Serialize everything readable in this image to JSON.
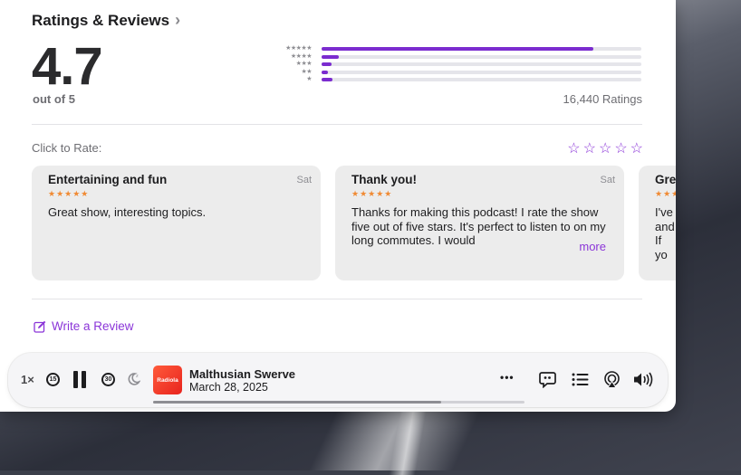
{
  "ratings": {
    "title": "Ratings & Reviews",
    "average": "4.7",
    "out_of": "out of 5",
    "count_label": "16,440 Ratings",
    "histogram": [
      {
        "stars": "★★★★★",
        "fraction": 0.85
      },
      {
        "stars": "★★★★",
        "fraction": 0.055
      },
      {
        "stars": "★★★",
        "fraction": 0.03
      },
      {
        "stars": "★★",
        "fraction": 0.02
      },
      {
        "stars": "★",
        "fraction": 0.035
      }
    ],
    "click_to_rate": "Click to Rate:",
    "rate_star": "☆"
  },
  "reviews": [
    {
      "title": "Entertaining and fun",
      "date": "Sat",
      "stars": "★★★★★",
      "body": "Great show, interesting topics.",
      "more": ""
    },
    {
      "title": "Thank you!",
      "date": "Sat",
      "stars": "★★★★★",
      "body": "Thanks for making this podcast! I rate the show five out of five stars. It's perfect to listen to on my long commutes. I would",
      "more": "more"
    },
    {
      "title": "Gre",
      "date": "",
      "stars": "★★★",
      "body": "I've and If yo",
      "more": ""
    }
  ],
  "write_review": "Write a Review",
  "player": {
    "speed": "1×",
    "skip_back": "15",
    "skip_forward": "30",
    "artwork_text": "Radiola",
    "episode_title": "Malthusian Swerve",
    "episode_date": "March 28, 2025",
    "progress": 0.775,
    "more_label": "•••"
  },
  "colors": {
    "accent": "#8b35d8",
    "histogram_bar": "#7b2ccf",
    "review_star": "#f08a33"
  }
}
